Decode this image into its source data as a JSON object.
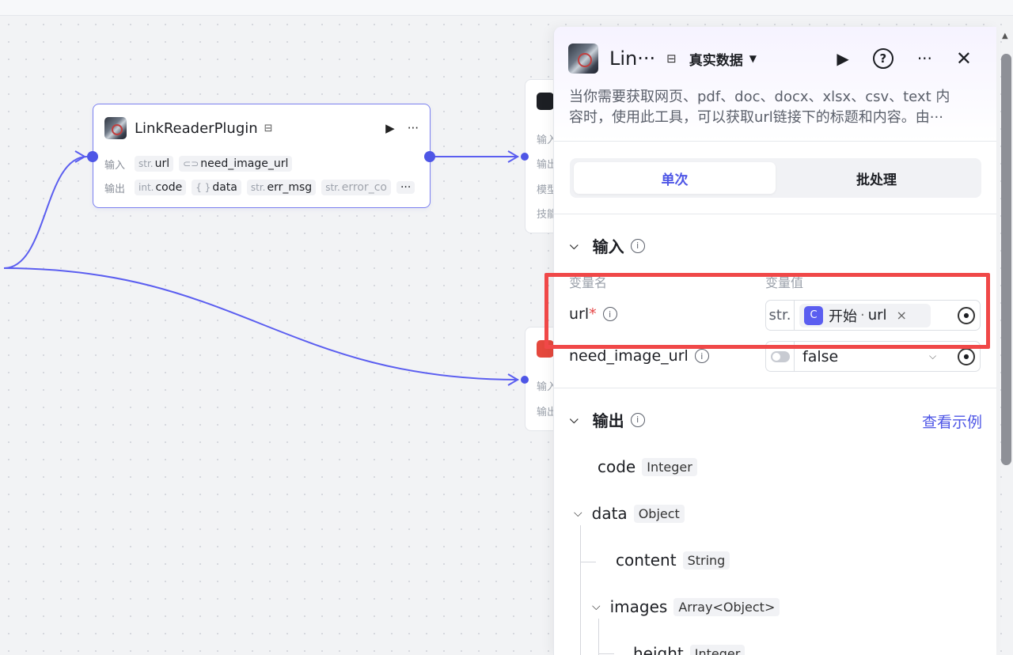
{
  "node": {
    "title": "LinkReaderPlugin",
    "input_label": "输入",
    "output_label": "输出",
    "inputs": [
      {
        "type": "str.",
        "name": "url"
      },
      {
        "type": "",
        "name": "need_image_url"
      }
    ],
    "outputs": [
      {
        "type": "int.",
        "name": "code"
      },
      {
        "type": "{ }",
        "name": "data"
      },
      {
        "type": "str.",
        "name": "err_msg"
      },
      {
        "type": "str.",
        "name": "error_co"
      }
    ],
    "more": "···"
  },
  "stub_nodes": {
    "top": {
      "labels": [
        "输入",
        "输出",
        "模型",
        "技能"
      ]
    },
    "bottom": {
      "labels": [
        "输入",
        "输出"
      ]
    }
  },
  "panel": {
    "title": "Lin···",
    "mode": "真实数据",
    "description_lines": [
      "当你需要获取网页、pdf、doc、docx、xlsx、csv、text 内",
      "容时，使用此工具，可以获取url链接下的标题和内容。由···"
    ],
    "tabs": [
      "单次",
      "批处理"
    ],
    "input_section": "输入",
    "col_name": "变量名",
    "col_value": "变量值",
    "fields": {
      "url": {
        "name": "url",
        "required_mark": "*",
        "type": "str.",
        "ref_node": "开始",
        "ref_sep": "·",
        "ref_var": "url"
      },
      "need_image_url": {
        "name": "need_image_url",
        "value": "false"
      }
    },
    "output_section": "输出",
    "view_example": "查看示例",
    "outputs": [
      {
        "name": "code",
        "type": "Integer"
      },
      {
        "name": "data",
        "type": "Object"
      },
      {
        "name": "content",
        "type": "String"
      },
      {
        "name": "images",
        "type": "Array<Object>"
      },
      {
        "name": "height",
        "type": "Integer"
      }
    ]
  },
  "colors": {
    "accent": "#4e56e6",
    "highlight": "#f04848",
    "edge": "#5b5ef0"
  }
}
